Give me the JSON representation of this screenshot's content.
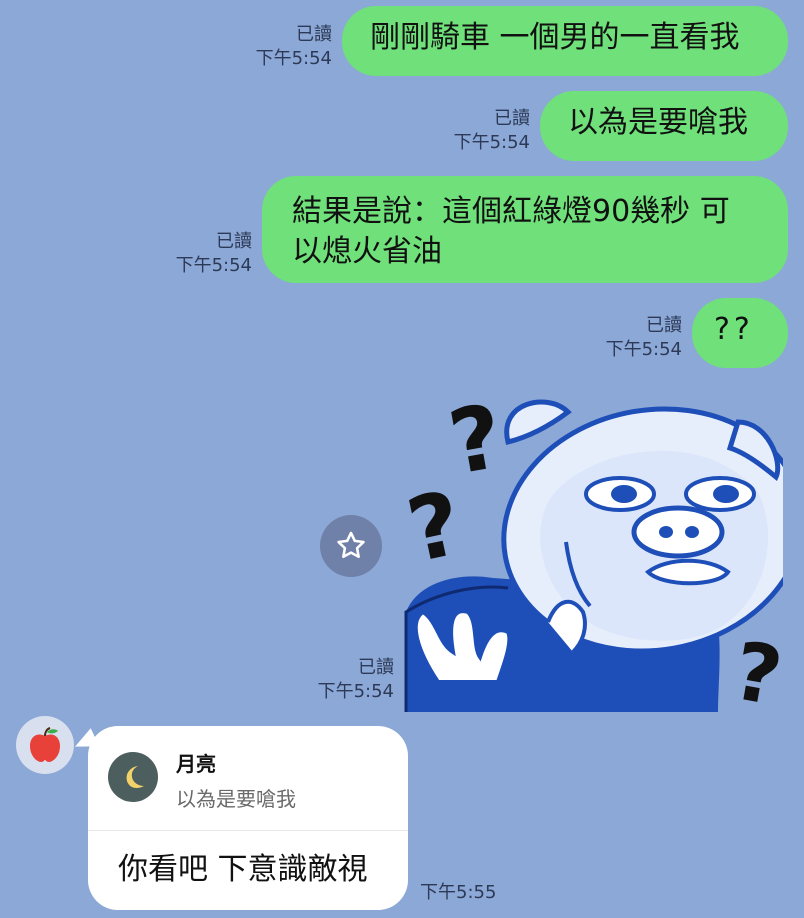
{
  "chat": {
    "messages": [
      {
        "text": "剛剛騎車 一個男的一直看我",
        "read": "已讀",
        "time": "下午5:54"
      },
      {
        "text": "以為是要嗆我",
        "read": "已讀",
        "time": "下午5:54"
      },
      {
        "text": "結果是說：這個紅綠燈90幾秒 可以熄火省油",
        "read": "已讀",
        "time": "下午5:54"
      },
      {
        "text": "??",
        "read": "已讀",
        "time": "下午5:54"
      }
    ],
    "sticker": {
      "read": "已讀",
      "time": "下午5:54"
    },
    "incoming": {
      "reply_name": "月亮",
      "reply_quote": "以為是要嗆我",
      "text": "你看吧 下意識敵視",
      "time": "下午5:55"
    }
  },
  "colors": {
    "background": "#8CA8D6",
    "outgoing_bubble": "#6FE07A",
    "incoming_bubble": "#FFFFFF",
    "meta_text": "#2D3A57"
  },
  "icons": {
    "star": "star-icon",
    "avatar": "apple-icon",
    "reply_avatar": "moon-icon"
  }
}
